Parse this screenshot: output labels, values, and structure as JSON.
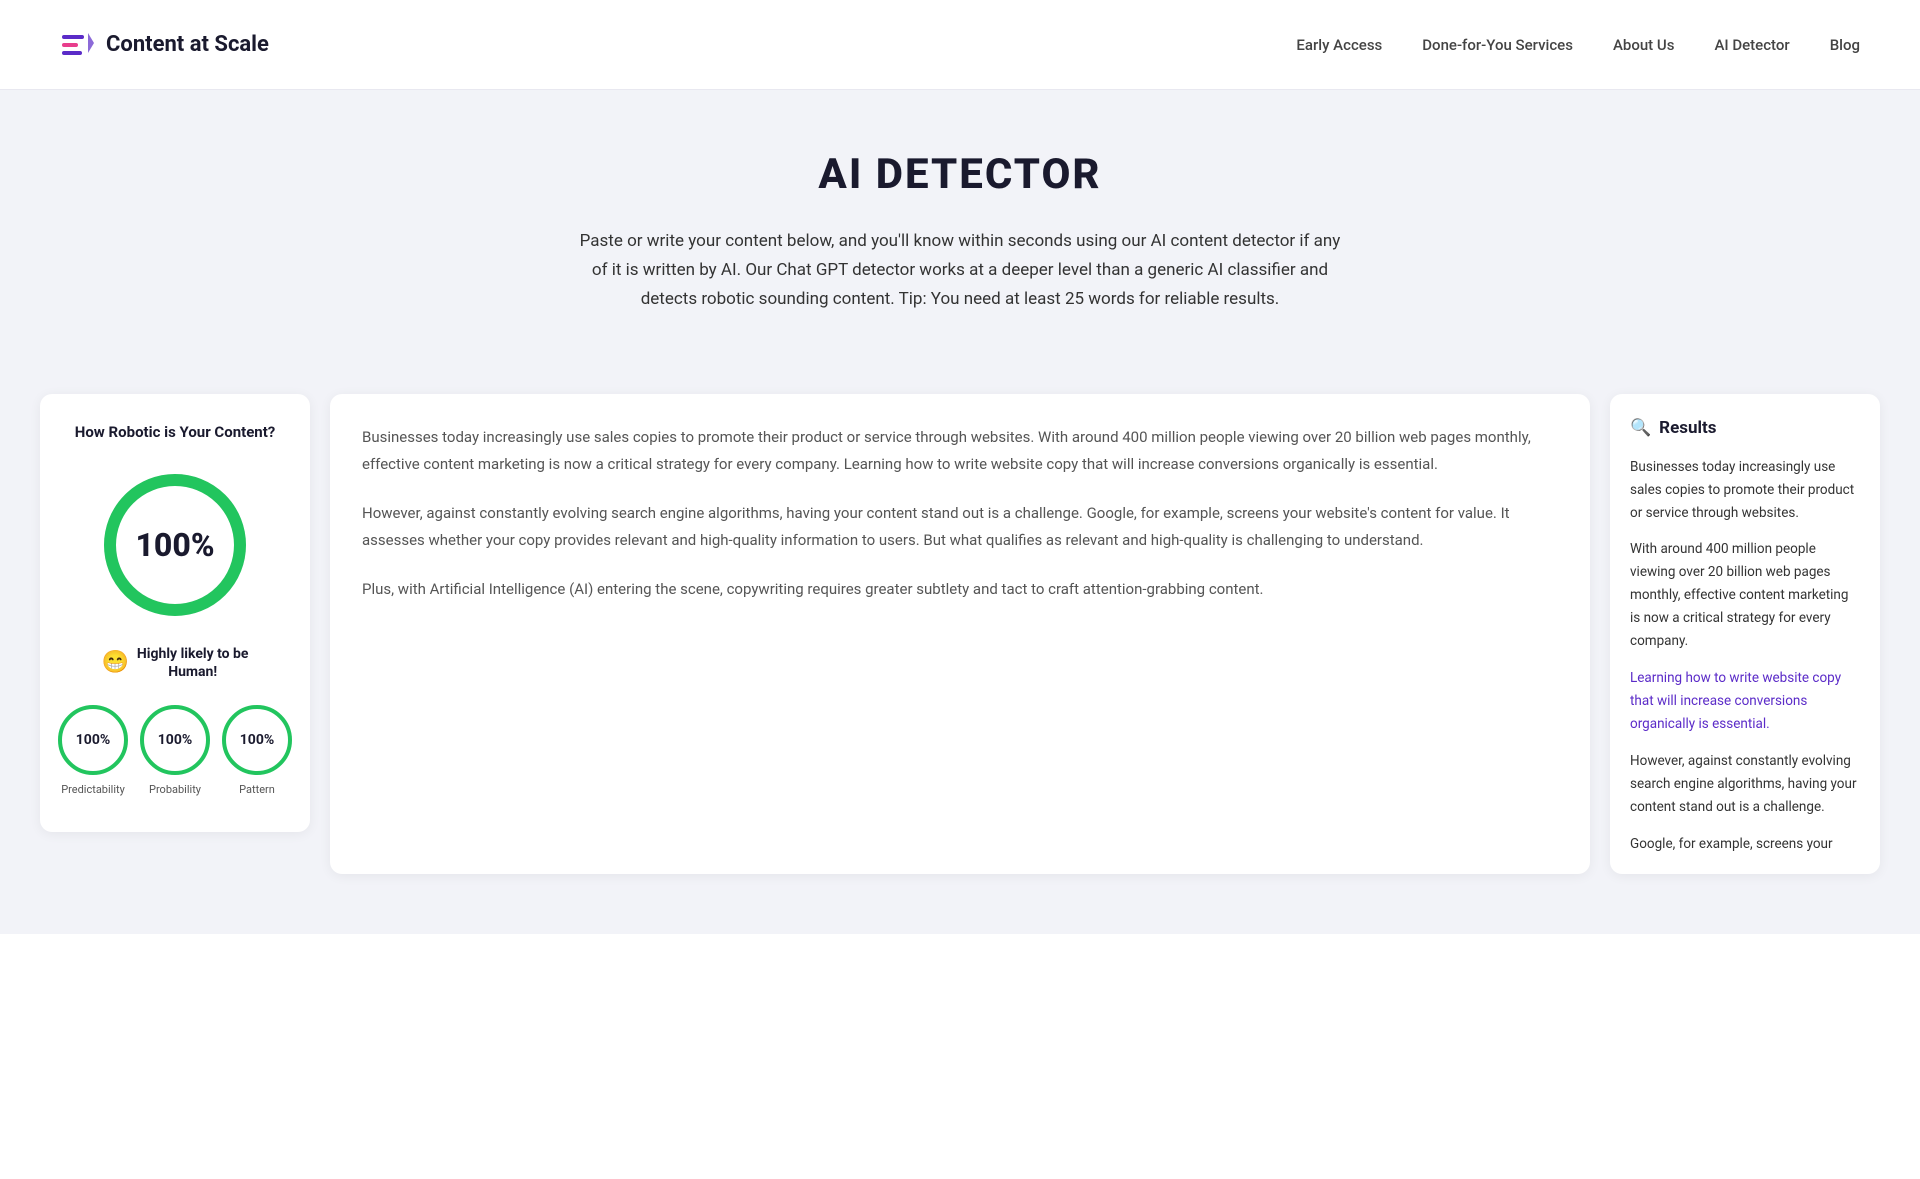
{
  "header": {
    "logo_text": "Content at Scale",
    "nav": {
      "early_access": "Early Access",
      "done_for_you": "Done-for-You Services",
      "about_us": "About Us",
      "ai_detector": "AI Detector",
      "blog": "Blog"
    }
  },
  "hero": {
    "title": "AI DETECTOR",
    "description": "Paste or write your content below, and you'll know within seconds using our AI content detector if any of it is written by AI. Our Chat GPT detector works at a deeper level than a generic AI classifier and detects robotic sounding content. Tip: You need at least 25 words for reliable results."
  },
  "left_panel": {
    "title": "How Robotic is Your Content?",
    "percentage": "100%",
    "emoji": "😁",
    "human_label_line1": "Highly likely to be",
    "human_label_line2": "Human!",
    "small_circles": [
      {
        "value": "100%",
        "label": "Predictability"
      },
      {
        "value": "100%",
        "label": "Probability"
      },
      {
        "value": "100%",
        "label": "Pattern"
      }
    ],
    "progress_percent": 100
  },
  "middle_panel": {
    "paragraphs": [
      "Businesses today increasingly use sales copies to promote their product or service through websites. With around 400 million people viewing over 20 billion web pages monthly, effective content marketing is now a critical strategy for every company. Learning how to write website copy that will increase conversions organically is essential.",
      "However, against constantly evolving search engine algorithms, having your content stand out is a challenge. Google, for example, screens your website's content for value. It assesses whether your copy provides relevant and high-quality information to users. But what qualifies as relevant and high-quality is challenging to understand.",
      "Plus, with Artificial Intelligence (AI) entering the scene, copywriting requires greater subtlety and tact to craft attention-grabbing content."
    ]
  },
  "right_panel": {
    "title": "Results",
    "paragraphs": [
      "Businesses today increasingly use sales copies to promote their product or service through websites.",
      "With around 400 million people viewing over 20 billion web pages monthly, effective content marketing is now a critical strategy for every company.",
      "Learning how to write website copy that will increase conversions organically is essential.",
      "However, against constantly evolving search engine algorithms, having your content stand out is a challenge.",
      "Google, for example, screens your"
    ],
    "highlighted_indices": [
      2
    ]
  }
}
